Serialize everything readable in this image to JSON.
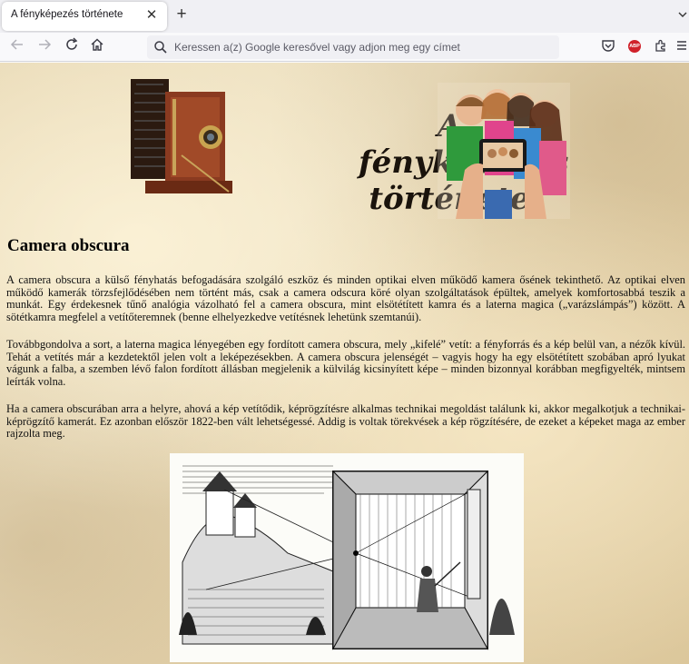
{
  "browser": {
    "tab_title": "A fényképezés története",
    "tab_close": "✕",
    "new_tab": "+",
    "url_placeholder": "Keressen a(z) Google keresővel vagy adjon meg egy címet",
    "icons": [
      "back-arrow-icon",
      "forward-arrow-icon",
      "reload-icon",
      "home-icon",
      "search-icon",
      "pocket-icon",
      "adblock-plus-icon",
      "extensions-icon",
      "menu-icon"
    ],
    "adblock_label": "ABP"
  },
  "banner": {
    "title_line1": "A fényképezés",
    "title_line2": "története",
    "images": [
      "antique-camera-image",
      "children-selfie-image"
    ]
  },
  "article": {
    "heading": "Camera obscura",
    "paragraphs": [
      "A camera obscura a külső fényhatás befogadására szolgáló eszköz és minden optikai elven működő kamera ősének tekinthető. Az optikai elven működő kamerák törzsfejlődésében nem történt más, csak a camera odscura köré olyan szolgáltatások épültek, amelyek komfortosabbá teszik a munkát. Egy érdekesnek tűnő analógia vázolható fel a camera obscura, mint elsötétített kamra és a laterna magica („varázslámpás”) között. A sötétkamra megfelel a vetítőteremnek (benne elhelyezkedve vetítésnek lehetünk szemtanúi).",
      "Továbbgondolva a sort, a laterna magica lényegében egy fordított camera obscura, mely „kifelé” vetít: a fényforrás és a kép belül van, a nézők kívül. Tehát a vetítés már a kezdetektől jelen volt a leképezésekben. A camera obscura jelenségét – vagyis hogy ha egy elsötétített szobában apró lyukat vágunk a falba, a szemben lévő falon fordított állásban megjelenik a külvilág kicsinyített képe – minden bizonnyal korábban megfigyelték, mintsem leírták volna.",
      "Ha a camera obscurában arra a helyre, ahová a kép vetítődik, képrögzítésre alkalmas technikai megoldást találunk ki, akkor megalkotjuk a technikai-képrögzítő kamerát. Ez azonban először 1822-ben vált lehetségessé. Addig is voltak törekvések a kép rögzítésére, de ezeket a képeket maga az ember rajzolta meg."
    ],
    "illustration": "camera-obscura-engraving"
  }
}
